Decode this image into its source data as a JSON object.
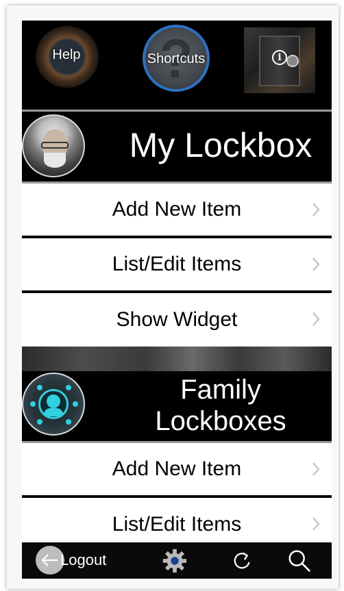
{
  "toolbar": {
    "help_label": "Help",
    "shortcuts_label": "Shortcuts",
    "info_glyph": "i"
  },
  "my_lockbox": {
    "title": "My Lockbox",
    "items": [
      {
        "label": "Add New Item"
      },
      {
        "label": "List/Edit Items"
      },
      {
        "label": "Show Widget"
      }
    ]
  },
  "family_lockboxes": {
    "title_line1": "Family",
    "title_line2": "Lockboxes",
    "items": [
      {
        "label": "Add New Item"
      },
      {
        "label": "List/Edit Items"
      }
    ]
  },
  "bottom_bar": {
    "logout_label": "Logout",
    "icons": [
      "back-arrow-icon",
      "gear-icon",
      "refresh-icon",
      "search-icon"
    ]
  },
  "colors": {
    "background": "#000000",
    "row_background": "#ffffff",
    "chevron": "#c7c7cc",
    "accent_blue": "#2f6fbf",
    "family_cyan": "#2fd0e0"
  }
}
